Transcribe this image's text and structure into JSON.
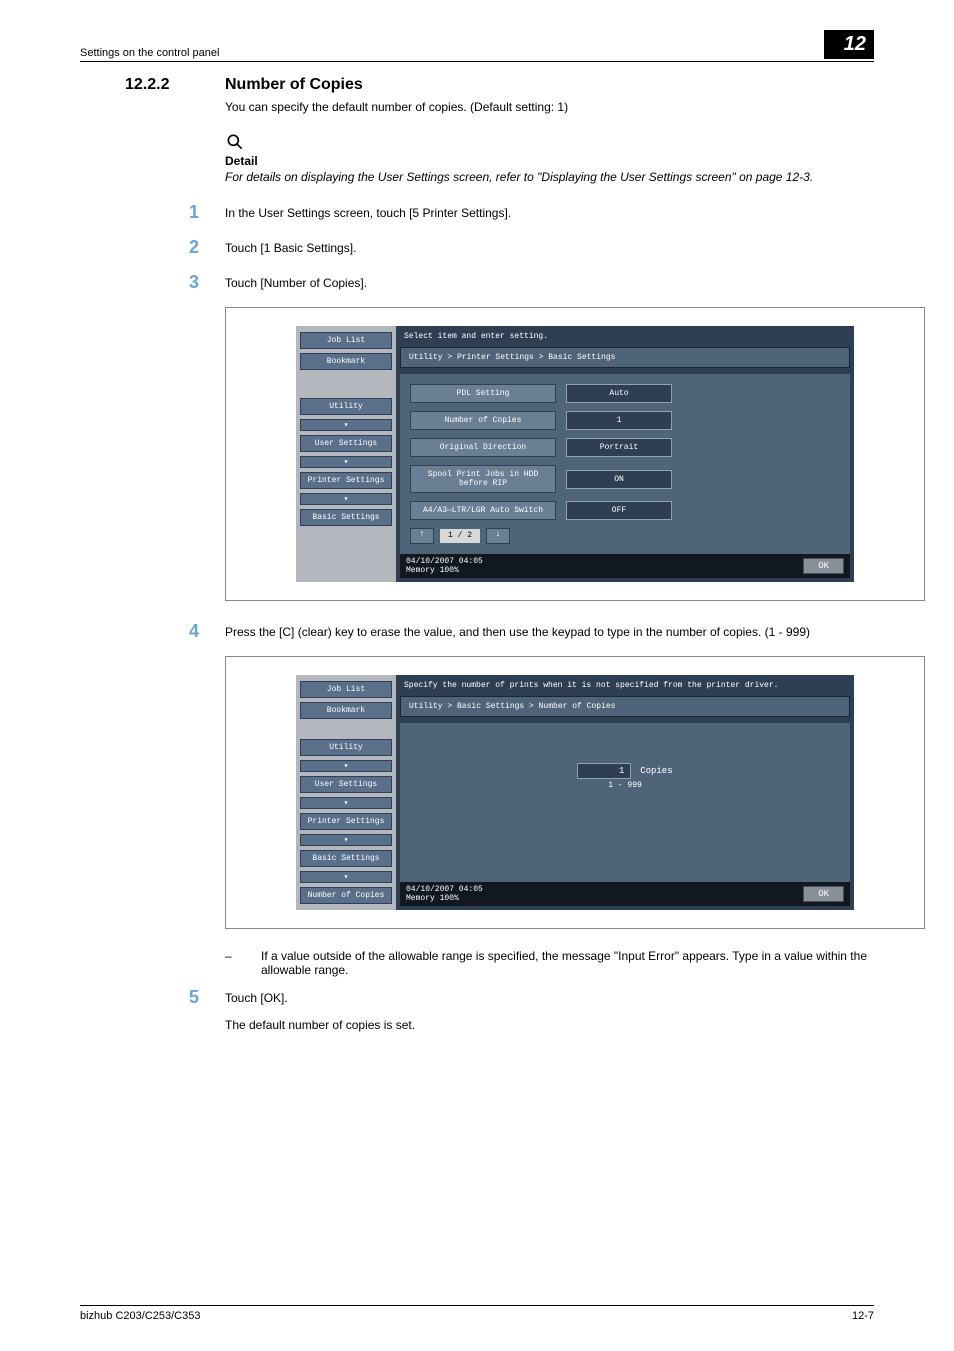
{
  "header": {
    "section_path": "Settings on the control panel",
    "chapter_number": "12"
  },
  "section": {
    "number": "12.2.2",
    "title": "Number of Copies",
    "intro": "You can specify the default number of copies. (Default setting: 1)"
  },
  "detail": {
    "label": "Detail",
    "text": "For details on displaying the User Settings screen, refer to \"Displaying the User Settings screen\" on page 12-3."
  },
  "steps": {
    "s1": {
      "num": "1",
      "text": "In the User Settings screen, touch [5 Printer Settings]."
    },
    "s2": {
      "num": "2",
      "text": "Touch [1 Basic Settings]."
    },
    "s3": {
      "num": "3",
      "text": "Touch [Number of Copies]."
    },
    "s4": {
      "num": "4",
      "text": "Press the [C] (clear) key to erase the value, and then use the keypad to type in the number of copies. (1 - 999)"
    },
    "s4_note": "If a value outside of the allowable range is specified, the message \"Input Error\" appears. Type in a value within the allowable range.",
    "s5": {
      "num": "5",
      "text": "Touch [OK]."
    },
    "closing": "The default number of copies is set."
  },
  "screen1": {
    "instruction": "Select item and enter setting.",
    "breadcrumb": "Utility > Printer Settings > Basic Settings",
    "side": {
      "job_list": "Job List",
      "bookmark": "Bookmark",
      "utility": "Utility",
      "user_settings": "User Settings",
      "printer_settings": "Printer Settings",
      "basic_settings": "Basic Settings"
    },
    "rows": {
      "pdl": {
        "label": "PDL Setting",
        "value": "Auto"
      },
      "copies": {
        "label": "Number of Copies",
        "value": "1"
      },
      "orient": {
        "label": "Original Direction",
        "value": "Portrait"
      },
      "spool": {
        "label": "Spool Print Jobs in HDD before RIP",
        "value": "ON"
      },
      "autosw": {
        "label": "A4/A3⇔LTR/LGR Auto Switch",
        "value": "OFF"
      }
    },
    "pager": {
      "up": "↑",
      "mid": "1 / 2",
      "down": "↓"
    },
    "status": {
      "left_line1": "04/10/2007   04:05",
      "left_line2": "Memory      100%",
      "ok": "OK"
    }
  },
  "screen2": {
    "instruction": "Specify the number of prints when it is not specified from the printer driver.",
    "breadcrumb": "Utility > Basic Settings > Number of Copies",
    "side": {
      "job_list": "Job List",
      "bookmark": "Bookmark",
      "utility": "Utility",
      "user_settings": "User Settings",
      "printer_settings": "Printer Settings",
      "basic_settings": "Basic Settings",
      "number_of_copies": "Number of Copies"
    },
    "copies": {
      "value": "1",
      "label": "Copies",
      "range": "1  -  999"
    },
    "status": {
      "left_line1": "04/10/2007   04:05",
      "left_line2": "Memory      100%",
      "ok": "OK"
    }
  },
  "footer": {
    "left": "bizhub C203/C253/C353",
    "right": "12-7"
  }
}
